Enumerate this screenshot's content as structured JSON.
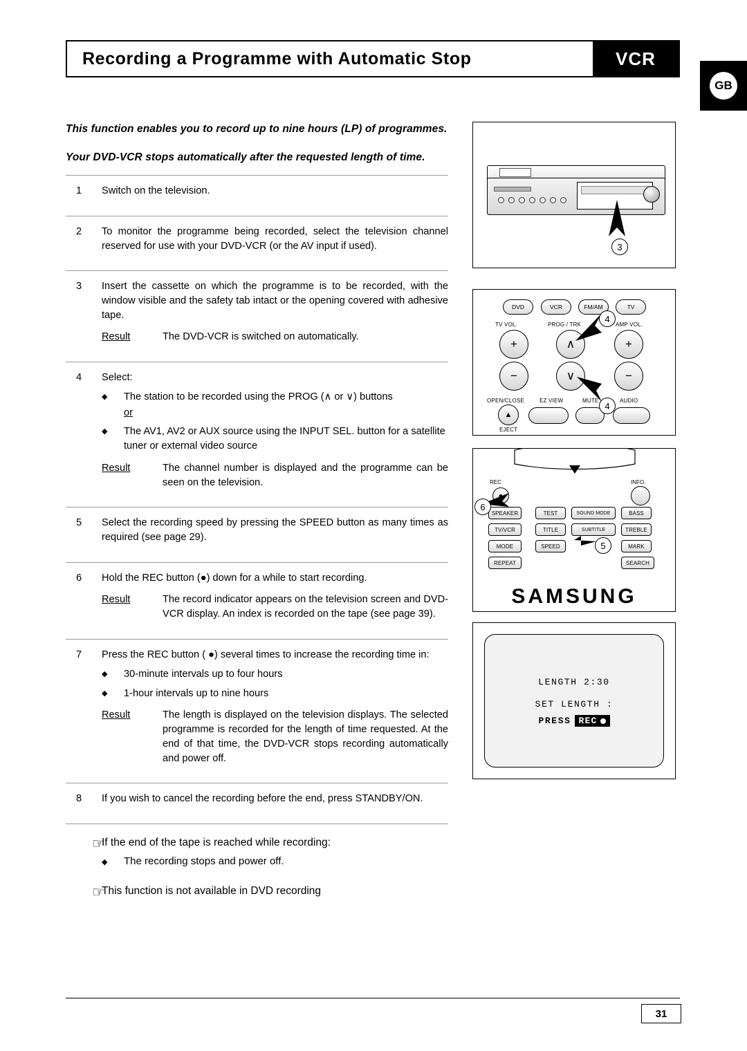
{
  "header": {
    "title": "Recording a Programme with Automatic Stop",
    "tag": "VCR",
    "region_badge": "GB"
  },
  "intro": {
    "line1": "This function enables you to record up to nine hours (LP) of programmes.",
    "line2": "Your DVD-VCR stops automatically after the requested length of time."
  },
  "steps": [
    {
      "num": "1",
      "text": "Switch on the television."
    },
    {
      "num": "2",
      "text": "To monitor the programme being recorded, select the television channel reserved for use with your DVD-VCR (or the AV input if used)."
    },
    {
      "num": "3",
      "text": "Insert the cassette on which the programme is to be recorded, with the window visible and the safety tab intact or the opening covered with adhesive tape.",
      "result_label": "Result",
      "result_text": "The DVD-VCR is switched on automatically."
    },
    {
      "num": "4",
      "text": "Select:",
      "bullets": [
        "The station to be recorded using the PROG (∧ or ∨) buttons",
        "The AV1, AV2 or AUX source using the INPUT SEL. button for a satellite tuner or external video source"
      ],
      "or_word": "or",
      "result_label": "Result",
      "result_text": "The channel number is displayed and the programme can be seen on the television."
    },
    {
      "num": "5",
      "text": "Select the recording speed by pressing the SPEED button as many times as required (see page 29)."
    },
    {
      "num": "6",
      "text": "Hold the REC button (●) down for a while to start recording.",
      "result_label": "Result",
      "result_text": "The record indicator appears on the television screen and DVD-VCR display. An index is recorded on the tape (see page 39)."
    },
    {
      "num": "7",
      "text": "Press the REC button ( ●) several times to increase the recording time in:",
      "bullets": [
        "30-minute intervals up to four hours",
        "1-hour intervals up to nine hours"
      ],
      "result_label": "Result",
      "result_text": "The length is displayed on the television displays. The selected programme is recorded for the length of time requested. At the end of that time, the DVD-VCR stops recording automatically and power off."
    },
    {
      "num": "8",
      "text": "If you wish to cancel the recording before the end, press STANDBY/ON."
    }
  ],
  "notes": [
    {
      "text": "If the end of the tape is reached while recording:",
      "sub": "The recording stops and power off."
    },
    {
      "text": "This function is not available in DVD recording"
    }
  ],
  "figures": {
    "device": {
      "callout": "3"
    },
    "remote_top": {
      "callout_upper": "4",
      "callout_lower": "4",
      "top_keys": [
        "DVD",
        "VCR",
        "FM/AM",
        "TV"
      ],
      "labels": {
        "tv_vol": "TV VOL.",
        "prog_trk": "PROG / TRK",
        "amp_vol": "AMP VOL.",
        "open_close": "OPEN/CLOSE",
        "ez_view": "EZ VIEW",
        "mute": "MUTE",
        "audio": "AUDIO",
        "eject": "EJECT"
      },
      "plus": "+",
      "minus": "−",
      "up_arrow": "∧",
      "down_arrow": "∨",
      "eject_arrow": "▲"
    },
    "remote_bottom": {
      "callout_rec": "6",
      "callout_speed": "5",
      "rec_label": "REC",
      "info_label": "INFO.",
      "buttons": [
        "SPEAKER",
        "TEST",
        "SOUND MODE",
        "BASS",
        "TV/VCR",
        "TITLE",
        "SUBTITLE",
        "TREBLE",
        "MODE",
        "SPEED",
        "MARK",
        "REPEAT",
        "SEARCH"
      ],
      "brand": "SAMSUNG"
    },
    "osd": {
      "line1": "LENGTH 2:30",
      "line2": "SET LENGTH :",
      "press_label": "PRESS",
      "rec_label": "REC"
    }
  },
  "footer": {
    "page_number": "31"
  }
}
